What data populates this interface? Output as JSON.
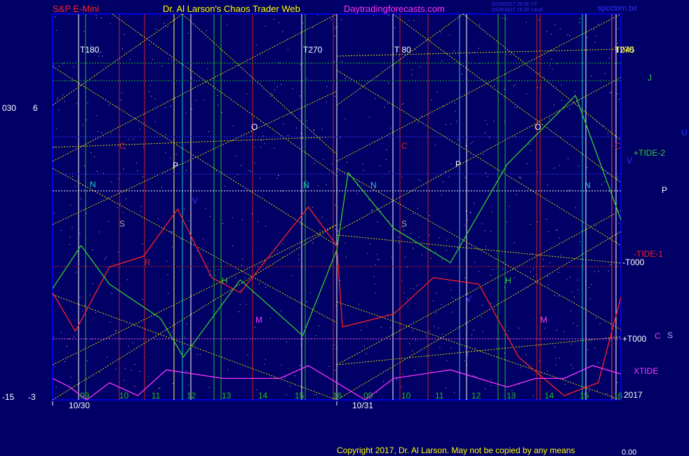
{
  "header": {
    "market": "S&P E-Mini",
    "author": "Dr. Al Larson's Chaos Trader Web",
    "site": "Daytradingforecasts.com",
    "stamp1": "10/29/2017 20:30 UT",
    "stamp2": "10/29/2017 15:30 Local",
    "file": "spcctom.txt"
  },
  "footer": {
    "copyright": "Copyright 2017, Dr. Al Larson. May not be copied by any means",
    "value": "0.00"
  },
  "colors": {
    "background": "#000066",
    "frame": "#0000dd",
    "price": "#ff2222",
    "tide2": "#33cc33",
    "xtide": "#ff33ff",
    "yellow": "#dddd00",
    "green": "#22bb22",
    "red": "#cc2222",
    "cyan": "#22cccc",
    "white": "#ffffff"
  },
  "chart_data": {
    "type": "line",
    "x_axis": {
      "days": [
        "10/30",
        "10/31"
      ],
      "hour_ticks": [
        "09",
        "10",
        "11",
        "12",
        "13",
        "14",
        "15",
        "16",
        "09",
        "10",
        "11",
        "12",
        "13",
        "14",
        "15",
        "16"
      ],
      "right_label": "2017"
    },
    "y_axis_labels": [
      {
        "text": "6",
        "value": 6
      },
      {
        "text": "030",
        "value": 6
      },
      {
        "text": "-3",
        "value": -3
      },
      {
        "text": "-15",
        "value": -3
      }
    ],
    "cycle_labels": [
      "T180",
      "T270",
      "T 80",
      "T270",
      "T045"
    ],
    "tidal_labels": [
      "+TIDE-2",
      "-TIDE-1",
      "-T000",
      "+T000",
      "XTIDE"
    ],
    "right_letters": [
      "J",
      "U",
      "V",
      "P",
      "C",
      "S"
    ],
    "planet_letters": [
      "C",
      "P",
      "N",
      "O",
      "S",
      "R",
      "M",
      "H",
      "V",
      "N",
      "C",
      "P",
      "N",
      "O",
      "S",
      "N",
      "H",
      "M",
      "V",
      "C"
    ],
    "ylim": [
      -3,
      6
    ],
    "series": [
      {
        "name": "price",
        "points": [
          [
            0,
            -0.5
          ],
          [
            0.04,
            -1.4
          ],
          [
            0.1,
            0.1
          ],
          [
            0.16,
            0.35
          ],
          [
            0.22,
            1.45
          ],
          [
            0.28,
            -0.15
          ],
          [
            0.33,
            -0.5
          ],
          [
            0.45,
            1.5
          ],
          [
            0.5,
            0.6
          ],
          [
            0.51,
            -1.3
          ],
          [
            0.6,
            -1.0
          ],
          [
            0.67,
            -0.15
          ],
          [
            0.75,
            -0.3
          ],
          [
            0.82,
            -2.0
          ],
          [
            0.9,
            -2.9
          ],
          [
            0.96,
            -2.6
          ],
          [
            1.0,
            -0.6
          ]
        ]
      },
      {
        "name": "tide2",
        "points": [
          [
            0,
            -0.4
          ],
          [
            0.05,
            0.6
          ],
          [
            0.1,
            -0.3
          ],
          [
            0.19,
            -1.1
          ],
          [
            0.23,
            -2.0
          ],
          [
            0.28,
            -1.1
          ],
          [
            0.33,
            -0.2
          ],
          [
            0.44,
            -1.5
          ],
          [
            0.5,
            0.5
          ],
          [
            0.52,
            2.3
          ],
          [
            0.6,
            1.0
          ],
          [
            0.7,
            0.2
          ],
          [
            0.8,
            2.5
          ],
          [
            0.92,
            4.1
          ],
          [
            1.0,
            1.2
          ]
        ]
      },
      {
        "name": "xtide",
        "points": [
          [
            0,
            -2.5
          ],
          [
            0.03,
            -2.7
          ],
          [
            0.06,
            -3.0
          ],
          [
            0.1,
            -2.6
          ],
          [
            0.15,
            -2.9
          ],
          [
            0.2,
            -2.3
          ],
          [
            0.25,
            -2.4
          ],
          [
            0.3,
            -2.5
          ],
          [
            0.4,
            -2.5
          ],
          [
            0.45,
            -2.2
          ],
          [
            0.5,
            -2.6
          ],
          [
            0.55,
            -3.0
          ],
          [
            0.6,
            -2.5
          ],
          [
            0.7,
            -2.3
          ],
          [
            0.8,
            -2.7
          ],
          [
            0.85,
            -2.5
          ],
          [
            0.9,
            -2.5
          ],
          [
            0.95,
            -2.2
          ],
          [
            1.0,
            -2.4
          ]
        ]
      }
    ]
  }
}
